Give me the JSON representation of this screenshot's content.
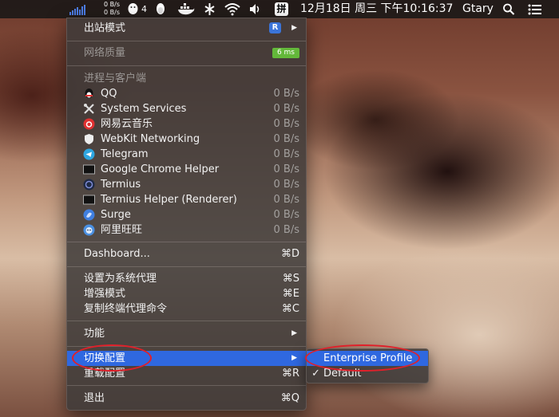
{
  "menubar": {
    "net_up": "0 B/s",
    "net_down": "0 B/s",
    "qq_badge": "4",
    "input_method": "拼",
    "datetime": "12月18日 周三 下午10:16:37",
    "username": "Gtary"
  },
  "menu": {
    "outbound_mode": {
      "label": "出站模式",
      "badge": "R"
    },
    "network_quality": {
      "label": "网络质量",
      "latency": "6 ms"
    },
    "process_header": "进程与客户端",
    "processes": [
      {
        "name": "QQ",
        "icon": "qq-icon",
        "speed": "0 B/s"
      },
      {
        "name": "System Services",
        "icon": "tools-icon",
        "speed": "0 B/s"
      },
      {
        "name": "网易云音乐",
        "icon": "netease-music-icon",
        "speed": "0 B/s"
      },
      {
        "name": "WebKit Networking",
        "icon": "shield-icon",
        "speed": "0 B/s"
      },
      {
        "name": "Telegram",
        "icon": "telegram-icon",
        "speed": "0 B/s"
      },
      {
        "name": "Google Chrome Helper",
        "icon": "terminal-window-icon",
        "speed": "0 B/s"
      },
      {
        "name": "Termius",
        "icon": "termius-icon",
        "speed": "0 B/s"
      },
      {
        "name": "Termius Helper (Renderer)",
        "icon": "terminal-window-icon",
        "speed": "0 B/s"
      },
      {
        "name": "Surge",
        "icon": "surge-icon",
        "speed": "0 B/s"
      },
      {
        "name": "阿里旺旺",
        "icon": "aliwangwang-icon",
        "speed": "0 B/s"
      }
    ],
    "dashboard": {
      "label": "Dashboard...",
      "shortcut": "⌘D"
    },
    "set_system_proxy": {
      "label": "设置为系统代理",
      "shortcut": "⌘S"
    },
    "enhanced_mode": {
      "label": "增强模式",
      "shortcut": "⌘E"
    },
    "copy_shell_proxy": {
      "label": "复制终端代理命令",
      "shortcut": "⌘C"
    },
    "features": {
      "label": "功能"
    },
    "switch_profile": {
      "label": "切换配置"
    },
    "reload_profile": {
      "label": "重载配置",
      "shortcut": "⌘R"
    },
    "quit": {
      "label": "退出",
      "shortcut": "⌘Q"
    }
  },
  "submenu": {
    "items": [
      {
        "label": "Enterprise Profile",
        "selected": false,
        "highlighted": true
      },
      {
        "label": "Default",
        "selected": true,
        "check": "✓"
      }
    ]
  },
  "colors": {
    "highlight": "#2f68e0",
    "annotation": "#e0202a",
    "latency_badge": "#63b83a",
    "mode_badge": "#3b74d8"
  }
}
